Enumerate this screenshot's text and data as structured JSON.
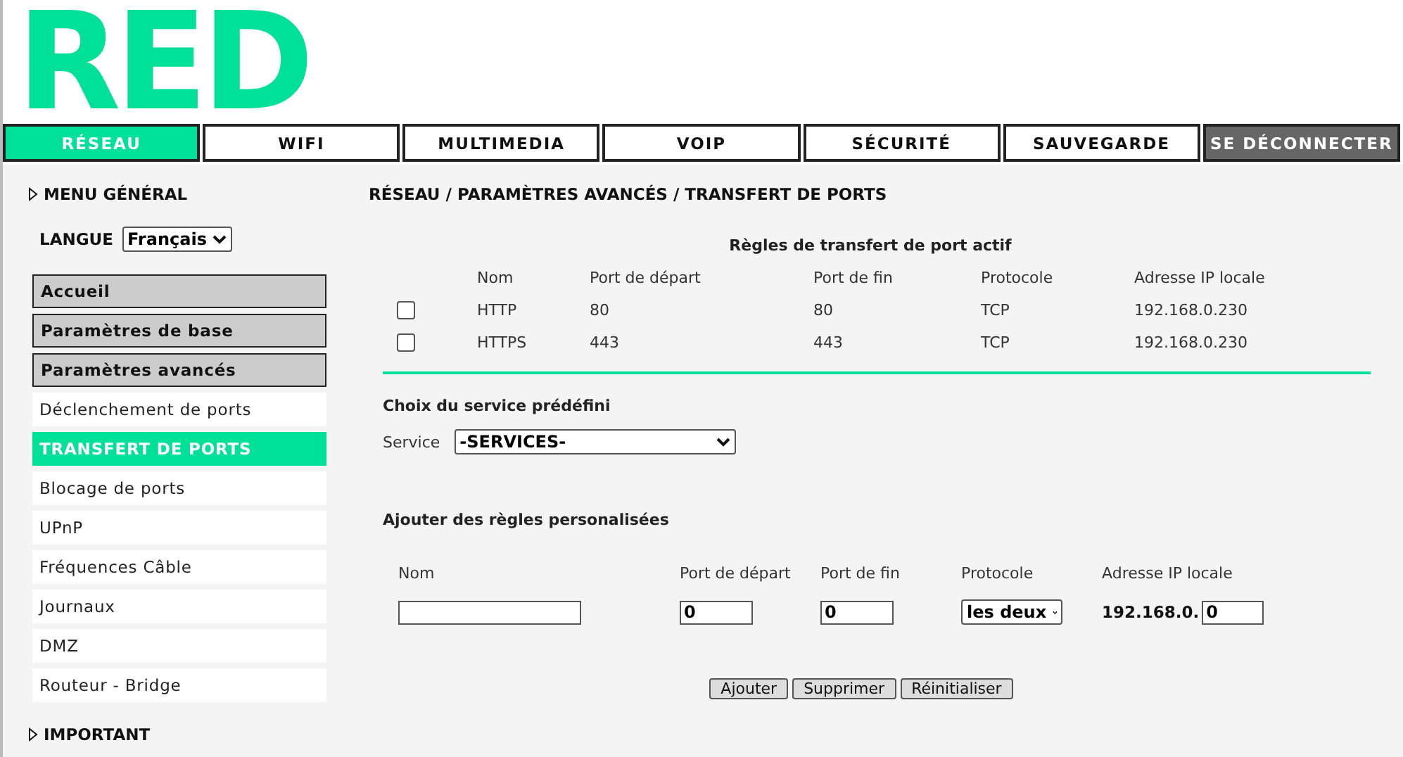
{
  "logo": {
    "text": "RED"
  },
  "tabs": [
    {
      "label": "RÉSEAU",
      "selected": true,
      "kind": "tab"
    },
    {
      "label": "WIFI",
      "selected": false,
      "kind": "tab"
    },
    {
      "label": "MULTIMEDIA",
      "selected": false,
      "kind": "tab"
    },
    {
      "label": "VOIP",
      "selected": false,
      "kind": "tab"
    },
    {
      "label": "SÉCURITÉ",
      "selected": false,
      "kind": "tab"
    },
    {
      "label": "SAUVEGARDE",
      "selected": false,
      "kind": "tab"
    },
    {
      "label": "SE DÉCONNECTER",
      "selected": false,
      "kind": "logout"
    }
  ],
  "sidebar": {
    "heading": "MENU GÉNÉRAL",
    "language": {
      "label": "LANGUE",
      "value": "Français"
    },
    "items": [
      {
        "label": "Accueil",
        "kind": "section",
        "selected": false
      },
      {
        "label": "Paramètres de base",
        "kind": "section",
        "selected": false
      },
      {
        "label": "Paramètres avancés",
        "kind": "section",
        "selected": false
      },
      {
        "label": "Déclenchement de ports",
        "kind": "link",
        "selected": false
      },
      {
        "label": "TRANSFERT DE PORTS",
        "kind": "link",
        "selected": true
      },
      {
        "label": "Blocage de ports",
        "kind": "link",
        "selected": false
      },
      {
        "label": "UPnP",
        "kind": "link",
        "selected": false
      },
      {
        "label": "Fréquences Câble",
        "kind": "link",
        "selected": false
      },
      {
        "label": "Journaux",
        "kind": "link",
        "selected": false
      },
      {
        "label": "DMZ",
        "kind": "link",
        "selected": false
      },
      {
        "label": "Routeur - Bridge",
        "kind": "link",
        "selected": false
      }
    ],
    "footer_heading": "IMPORTANT"
  },
  "breadcrumb": "RÉSEAU / PARAMÈTRES AVANCÉS / TRANSFERT DE PORTS",
  "active_rules": {
    "title": "Règles de transfert de port actif",
    "columns": [
      "Nom",
      "Port de départ",
      "Port de fin",
      "Protocole",
      "Adresse IP locale"
    ],
    "rows": [
      {
        "checked": false,
        "cells": [
          "HTTP",
          "80",
          "80",
          "TCP",
          "192.168.0.230"
        ]
      },
      {
        "checked": false,
        "cells": [
          "HTTPS",
          "443",
          "443",
          "TCP",
          "192.168.0.230"
        ]
      }
    ]
  },
  "predefined": {
    "title": "Choix du service prédéfini",
    "label": "Service",
    "value": "-SERVICES-"
  },
  "custom": {
    "title": "Ajouter des règles personalisées",
    "columns": [
      "Nom",
      "Port de départ",
      "Port de fin",
      "Protocole",
      "Adresse IP locale"
    ],
    "start_port": "0",
    "end_port": "0",
    "protocol": "les deux",
    "ip_prefix": "192.168.0.",
    "ip_suffix": "0"
  },
  "buttons": [
    "Ajouter",
    "Supprimer",
    "Réinitialiser"
  ]
}
